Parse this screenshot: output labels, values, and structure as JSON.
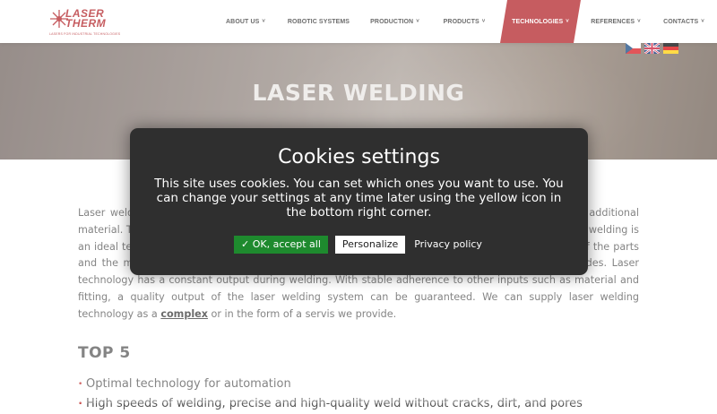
{
  "brand": {
    "name_line1": "LASER",
    "name_line2": "THERM",
    "tagline": "LASERS FOR INDUSTRIAL TECHNOLOGIES",
    "accent": "#b01e23"
  },
  "nav": {
    "items": [
      {
        "label": "ABOUT US",
        "has_caret": true
      },
      {
        "label": "ROBOTIC SYSTEMS",
        "has_caret": false
      },
      {
        "label": "PRODUCTION",
        "has_caret": true
      },
      {
        "label": "PRODUCTS",
        "has_caret": true
      },
      {
        "label": "TECHNOLOGIES",
        "has_caret": true,
        "active": true
      },
      {
        "label": "REFERENCES",
        "has_caret": true
      },
      {
        "label": "CONTACTS",
        "has_caret": true
      }
    ],
    "caret": "˅"
  },
  "languages": [
    "cz-flag-icon",
    "uk-flag-icon",
    "de-flag-icon"
  ],
  "hero": {
    "title": "LASER WELDING"
  },
  "content": {
    "paragraph": "Laser welding is a technology that creates a strong, high-quality weld joint without the need for additional material. Thanks to precise control of the heat input, process speed, stability and repeatability, laser welding is an ideal technology for automation. The advantages of laser weld make from the low deformation of the parts and the minimal heat-affected zone. In addition, laser welding is contactless and without electrodes. Laser technology has a constant output during welding. With stable adherence to other inputs such as material and fitting, a quality output of the laser welding system can be guaranteed. We can supply laser welding technology as a",
    "link_text": "complex",
    "paragraph_end": "or in the form of a servis we provide.",
    "top5_title": "TOP 5",
    "top5_items": [
      "Optimal technology for automation",
      "High speeds of welding, precise and high-quality weld without cracks, dirt, and pores"
    ]
  },
  "cookies": {
    "title": "Cookies settings",
    "message": "This site uses cookies. You can set which ones you want to use. You can change your settings at any time later using the yellow icon in the bottom right corner.",
    "accept_label": "✓ OK, accept all",
    "personalize_label": "Personalize",
    "policy_label": "Privacy policy",
    "accept_color": "#1e8a2e"
  }
}
